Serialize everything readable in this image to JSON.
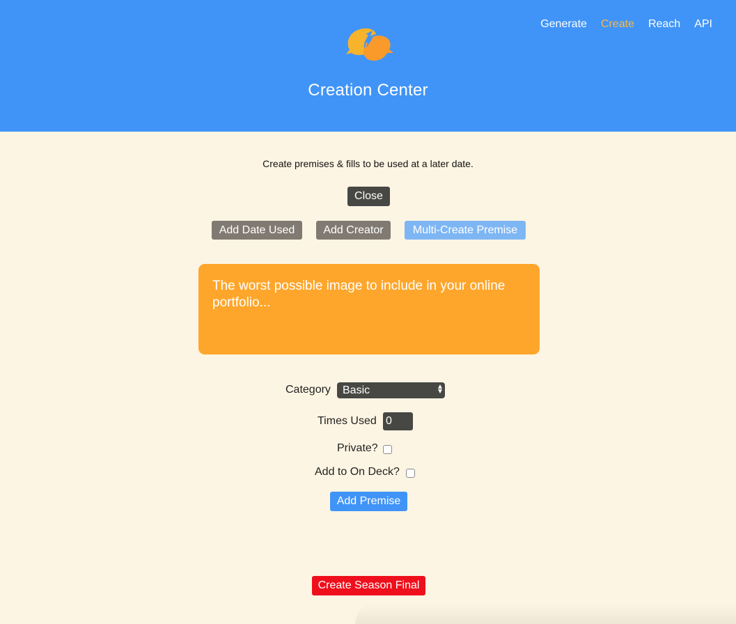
{
  "header": {
    "title": "Creation Center",
    "logo_icon": "speech-bubbles-logo",
    "brand_color": "#4094f7",
    "nav": [
      {
        "label": "Generate",
        "active": false
      },
      {
        "label": "Create",
        "active": true
      },
      {
        "label": "Reach",
        "active": false
      },
      {
        "label": "API",
        "active": false
      }
    ]
  },
  "main": {
    "intro": "Create premises & fills to be used at a later date.",
    "close_label": "Close",
    "actions": {
      "add_date_used": "Add Date Used",
      "add_creator": "Add Creator",
      "multi_create": "Multi-Create Premise"
    },
    "premise_text": "The worst possible image to include in your online portfolio...",
    "form": {
      "category_label": "Category",
      "category_value": "Basic",
      "times_used_label": "Times Used",
      "times_used_value": "0",
      "private_label": "Private?",
      "private_checked": false,
      "on_deck_label": "Add to On Deck?",
      "on_deck_checked": false,
      "add_premise_label": "Add Premise"
    },
    "season_final_label": "Create Season Final"
  }
}
